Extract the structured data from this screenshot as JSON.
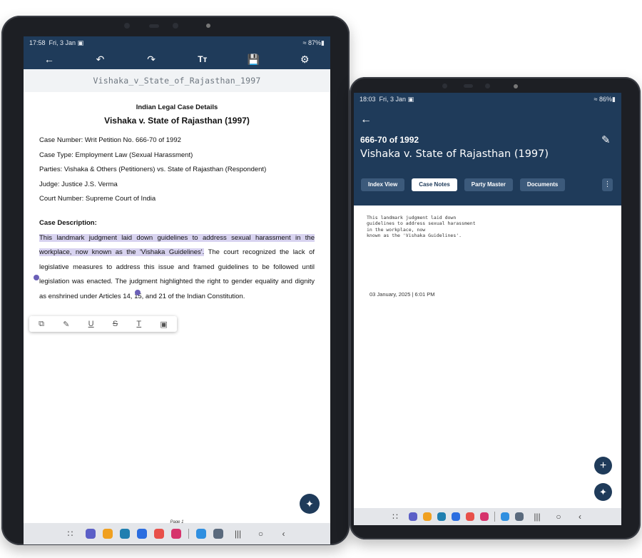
{
  "tabletA": {
    "status": {
      "time": "17:58",
      "date": "Fri, 3 Jan",
      "battery": "87%"
    },
    "toolbar": {
      "back_icon": "arrow-left-icon",
      "undo_icon": "undo-icon",
      "redo_icon": "redo-icon",
      "text_size_icon": "text-size-icon",
      "save_icon": "save-icon",
      "settings_icon": "gear-icon"
    },
    "doc_title": "Vishaka_v_State_of_Rajasthan_1997",
    "document": {
      "heading": "Indian Legal Case Details",
      "case_name": "Vishaka v. State of Rajasthan (1997)",
      "fields": [
        "Case Number: Writ Petition No. 666-70 of 1992",
        "Case Type: Employment Law (Sexual Harassment)",
        "Parties: Vishaka & Others (Petitioners) vs. State of Rajasthan (Respondent)",
        "Judge: Justice J.S. Verma",
        "Court Number: Supreme Court of India"
      ],
      "description_heading": "Case Description:",
      "desc_highlighted": "This landmark judgment laid down guidelines to address sexual harassment in the workplace, now known as the 'Vishaka Guidelines'.",
      "desc_rest": " The court recognized the lack of legislative measures to address this issue and framed guidelines to be followed until legislation was enacted. The judgment highlighted the right to gender equality and dignity as enshrined under Articles 14, 15, and 21 of the Indian Constitution."
    },
    "page_label": "Page 1"
  },
  "tabletB": {
    "status": {
      "time": "18:03",
      "date": "Fri, 3 Jan",
      "battery": "86%"
    },
    "case_number": "666-70 of 1992",
    "case_title": "Vishaka v. State of Rajasthan (1997)",
    "tabs": [
      {
        "label": "Index View",
        "active": false
      },
      {
        "label": "Case Notes",
        "active": true
      },
      {
        "label": "Party Master",
        "active": false
      },
      {
        "label": "Documents",
        "active": false
      }
    ],
    "notes_lines": [
      "This landmark judgment laid down",
      "guidelines to address sexual harassment",
      "in the workplace, now",
      "known as the 'Vishaka Guidelines'."
    ],
    "note_date": "03 January, 2025 | 6:01 PM"
  },
  "colors": {
    "header": "#1f3b5a",
    "highlight": "#d8d3f0",
    "handle": "#6a5fb7"
  },
  "nav_apps": [
    "#5b5fc7",
    "#f0a020",
    "#1f7fb0",
    "#2b6de0",
    "#e8504a",
    "#d6336c",
    "#2f8fe0",
    "#5a6a7d"
  ]
}
